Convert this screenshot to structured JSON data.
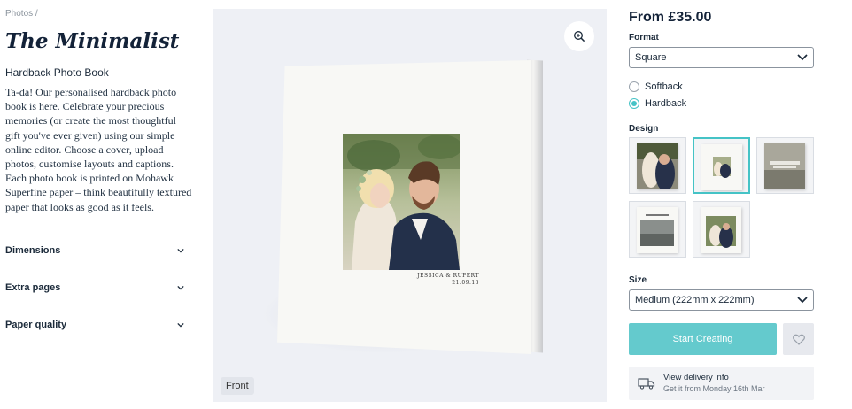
{
  "breadcrumb": "Photos /",
  "product": {
    "title": "The Minimalist",
    "subtitle": "Hardback Photo Book",
    "description": "Ta-da! Our personalised hardback photo book is here. Celebrate your precious memories (or create the most thoughtful gift you've ever given) using our simple online editor. Choose a cover, upload photos, customise layouts and captions. Each photo book is printed on Mohawk Superfine paper – think beautifully textured paper that looks as good as it feels."
  },
  "accordions": [
    {
      "label": "Dimensions"
    },
    {
      "label": "Extra pages"
    },
    {
      "label": "Paper quality"
    }
  ],
  "preview": {
    "cover_names": "JESSICA & RUPERT",
    "cover_date": "21.09.18",
    "view_label": "Front",
    "zoom_icon": "zoom-in-icon"
  },
  "pricing": {
    "price": "From £35.00"
  },
  "format": {
    "label": "Format",
    "selected": "Square",
    "options": [
      {
        "label": "Softback",
        "checked": false
      },
      {
        "label": "Hardback",
        "checked": true
      }
    ]
  },
  "design": {
    "label": "Design",
    "thumbnails": [
      {
        "name": "design-photo-cover",
        "selected": false
      },
      {
        "name": "design-minimal-cover",
        "selected": true
      },
      {
        "name": "design-landscape-cover",
        "selected": false
      },
      {
        "name": "design-city-cover",
        "selected": false
      },
      {
        "name": "design-framed-cover",
        "selected": false
      }
    ]
  },
  "size": {
    "label": "Size",
    "selected": "Medium (222mm x 222mm)"
  },
  "actions": {
    "start_label": "Start Creating",
    "favourite_icon": "heart-icon"
  },
  "delivery": {
    "title": "View delivery info",
    "subtitle": "Get it from Monday 16th Mar"
  },
  "colors": {
    "accent": "#45c3c6",
    "button": "#64cacd",
    "text": "#132238"
  }
}
